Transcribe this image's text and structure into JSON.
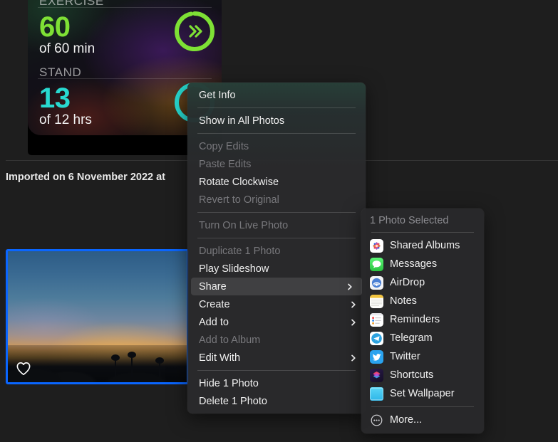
{
  "library": {
    "section_header": "Imported on 6 November 2022 at",
    "activity_card": {
      "exercise_label": "EXERCISE",
      "exercise_value": "60",
      "exercise_goal": "of 60 min",
      "exercise_color": "#7ee035",
      "stand_label": "STAND",
      "stand_value": "13",
      "stand_goal": "of 12 hrs",
      "stand_color": "#28d9d0"
    },
    "photo": {
      "alt": "sunset-photo",
      "favorite_icon": "heart-icon",
      "selected": true,
      "selection_color": "#0a66ff"
    }
  },
  "context_menu": {
    "groups": [
      {
        "items": [
          {
            "label": "Get Info",
            "disabled": false,
            "submenu": false
          }
        ]
      },
      {
        "items": [
          {
            "label": "Show in All Photos",
            "disabled": false,
            "submenu": false
          }
        ]
      },
      {
        "items": [
          {
            "label": "Copy Edits",
            "disabled": true,
            "submenu": false
          },
          {
            "label": "Paste Edits",
            "disabled": true,
            "submenu": false
          },
          {
            "label": "Rotate Clockwise",
            "disabled": false,
            "submenu": false
          },
          {
            "label": "Revert to Original",
            "disabled": true,
            "submenu": false
          }
        ]
      },
      {
        "items": [
          {
            "label": "Turn On Live Photo",
            "disabled": true,
            "submenu": false
          }
        ]
      },
      {
        "items": [
          {
            "label": "Duplicate 1 Photo",
            "disabled": true,
            "submenu": false
          },
          {
            "label": "Play Slideshow",
            "disabled": false,
            "submenu": false
          },
          {
            "label": "Share",
            "disabled": false,
            "submenu": true,
            "highlighted": true
          },
          {
            "label": "Create",
            "disabled": false,
            "submenu": true
          },
          {
            "label": "Add to",
            "disabled": false,
            "submenu": true
          },
          {
            "label": "Add to Album",
            "disabled": true,
            "submenu": false
          },
          {
            "label": "Edit With",
            "disabled": false,
            "submenu": true
          }
        ]
      },
      {
        "items": [
          {
            "label": "Hide 1 Photo",
            "disabled": false,
            "submenu": false
          },
          {
            "label": "Delete 1 Photo",
            "disabled": false,
            "submenu": false
          }
        ]
      }
    ]
  },
  "share_submenu": {
    "title": "1 Photo Selected",
    "items": [
      {
        "label": "Shared Albums",
        "icon": "shared-albums-icon"
      },
      {
        "label": "Messages",
        "icon": "messages-icon"
      },
      {
        "label": "AirDrop",
        "icon": "airdrop-icon"
      },
      {
        "label": "Notes",
        "icon": "notes-icon"
      },
      {
        "label": "Reminders",
        "icon": "reminders-icon"
      },
      {
        "label": "Telegram",
        "icon": "telegram-icon"
      },
      {
        "label": "Twitter",
        "icon": "twitter-icon"
      },
      {
        "label": "Shortcuts",
        "icon": "shortcuts-icon"
      },
      {
        "label": "Set Wallpaper",
        "icon": "set-wallpaper-icon"
      }
    ],
    "more": {
      "label": "More...",
      "icon": "more-icon"
    }
  }
}
